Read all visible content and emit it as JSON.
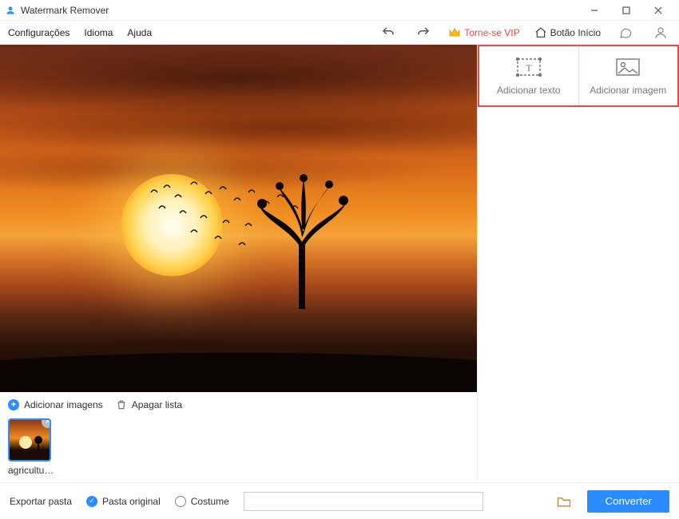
{
  "window": {
    "title": "Watermark Remover"
  },
  "menu": {
    "config": "Configurações",
    "language": "Idioma",
    "help": "Ajuda",
    "vip": "Torne-se VIP",
    "home": "Botão Início"
  },
  "right_panel": {
    "add_text": "Adicionar texto",
    "add_image": "Adicionar imagem"
  },
  "thumbbar": {
    "add_images": "Adicionar imagens",
    "clear_list": "Apagar lista",
    "items": [
      {
        "name": "agricultur..."
      }
    ]
  },
  "footer": {
    "export_label": "Exportar pasta",
    "original": "Pasta original",
    "custom": "Costume",
    "custom_path": "",
    "convert": "Converter",
    "selected": "original"
  }
}
